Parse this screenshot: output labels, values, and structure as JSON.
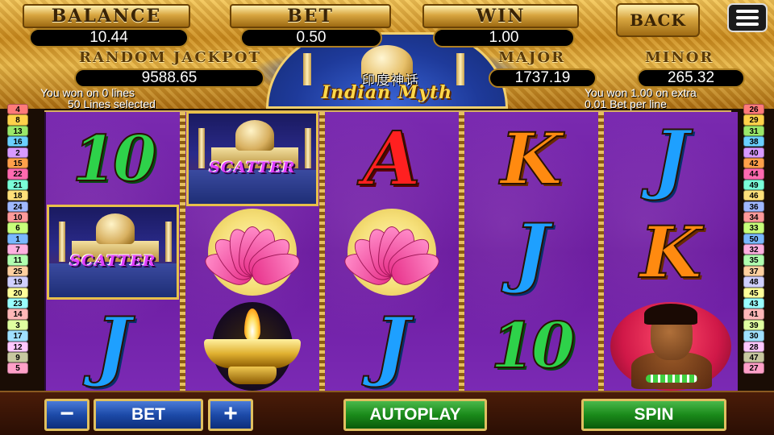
{
  "header": {
    "balance_label": "BALANCE",
    "balance_value": "10.44",
    "bet_label": "BET",
    "bet_value": "0.50",
    "win_label": "WIN",
    "win_value": "1.00",
    "back_label": "BACK",
    "random_jackpot_label": "RANDOM JACKPOT",
    "random_jackpot_value": "9588.65",
    "major_label": "MAJOR",
    "major_value": "1737.19",
    "minor_label": "MINOR",
    "minor_value": "265.32",
    "title_cn": "印度神话",
    "title_en": "Indian Myth",
    "msg_left_1": "You won on 0 lines",
    "msg_left_2": "50 Lines selected",
    "msg_right_1": "You won 1.00 on extra",
    "msg_right_2": "0.01 Bet per line"
  },
  "reels": [
    [
      "10",
      "scatter",
      "J"
    ],
    [
      "scatter",
      "lotus",
      "lamp"
    ],
    [
      "A",
      "lotus",
      "J"
    ],
    [
      "K",
      "J",
      "10"
    ],
    [
      "J",
      "K",
      "warrior"
    ]
  ],
  "scatter_text": "SCATTER",
  "lines_left": [
    "4",
    "8",
    "13",
    "16",
    "2",
    "15",
    "22",
    "21",
    "18",
    "24",
    "10",
    "6",
    "1",
    "7",
    "11",
    "25",
    "19",
    "20",
    "23",
    "14",
    "3",
    "17",
    "12",
    "9",
    "5"
  ],
  "lines_right": [
    "26",
    "29",
    "31",
    "38",
    "40",
    "42",
    "44",
    "49",
    "46",
    "36",
    "34",
    "33",
    "50",
    "32",
    "35",
    "37",
    "48",
    "45",
    "43",
    "41",
    "39",
    "30",
    "28",
    "47",
    "27"
  ],
  "line_colors": [
    "#ff7a7a",
    "#ffd24a",
    "#9ae86a",
    "#6ad0ff",
    "#d89aff",
    "#ffa04a",
    "#ff6ab0",
    "#7affd8",
    "#ffe07a",
    "#a0b8ff",
    "#ff9a9a",
    "#c8ff7a",
    "#7ab8ff",
    "#ffb0e0",
    "#b0ffb0",
    "#ffd0a0",
    "#d0d0ff",
    "#ffff9a",
    "#9affff",
    "#ffb8b8",
    "#e0ffa0",
    "#a0e0ff",
    "#ffc8ff",
    "#c8c8a0",
    "#ffa0c8"
  ],
  "controls": {
    "minus": "−",
    "bet": "BET",
    "plus": "+",
    "autoplay": "AUTOPLAY",
    "spin": "SPIN"
  }
}
